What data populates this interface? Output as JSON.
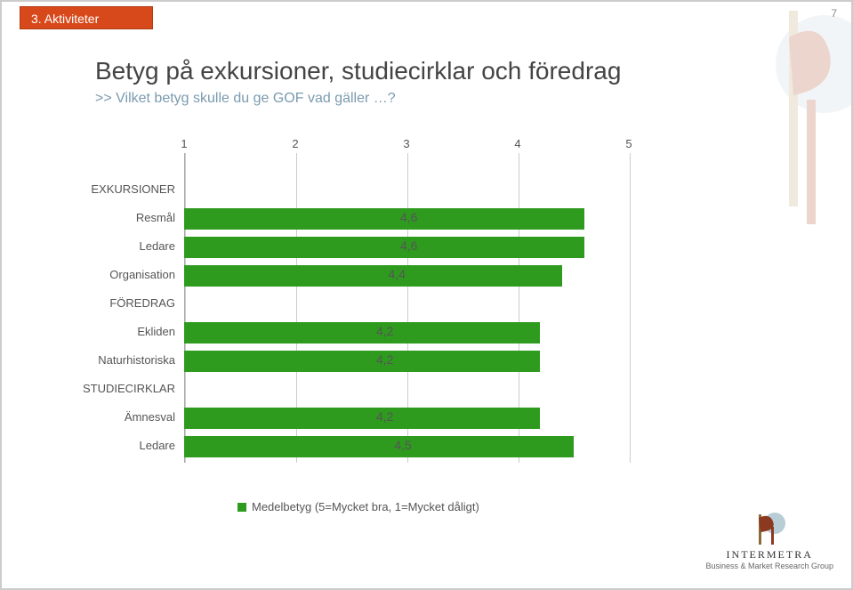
{
  "pagenum": "7",
  "tab": "3. Aktiviteter",
  "title": "Betyg på exkursioner, studiecirklar och föredrag",
  "subtitle": ">> Vilket betyg skulle du ge GOF vad gäller …?",
  "legend": "Medelbetyg (5=Mycket bra, 1=Mycket dåligt)",
  "footer": {
    "brand": "INTERMETRA",
    "tagline": "Business & Market Research Group"
  },
  "chart_data": {
    "type": "bar",
    "xlabel": "",
    "ylabel": "",
    "xlim": [
      1,
      5
    ],
    "ticks": [
      1,
      2,
      3,
      4,
      5
    ],
    "rows": [
      {
        "kind": "header",
        "label": "EXKURSIONER"
      },
      {
        "kind": "bar",
        "label": "Resmål",
        "value": 4.6,
        "valueLabel": "4,6"
      },
      {
        "kind": "bar",
        "label": "Ledare",
        "value": 4.6,
        "valueLabel": "4,6"
      },
      {
        "kind": "bar",
        "label": "Organisation",
        "value": 4.4,
        "valueLabel": "4,4"
      },
      {
        "kind": "header",
        "label": "FÖREDRAG"
      },
      {
        "kind": "bar",
        "label": "Ekliden",
        "value": 4.2,
        "valueLabel": "4,2"
      },
      {
        "kind": "bar",
        "label": "Naturhistoriska",
        "value": 4.2,
        "valueLabel": "4,2"
      },
      {
        "kind": "header",
        "label": "STUDIECIRKLAR"
      },
      {
        "kind": "bar",
        "label": "Ämnesval",
        "value": 4.2,
        "valueLabel": "4,2"
      },
      {
        "kind": "bar",
        "label": "Ledare",
        "value": 4.5,
        "valueLabel": "4,5"
      }
    ]
  }
}
